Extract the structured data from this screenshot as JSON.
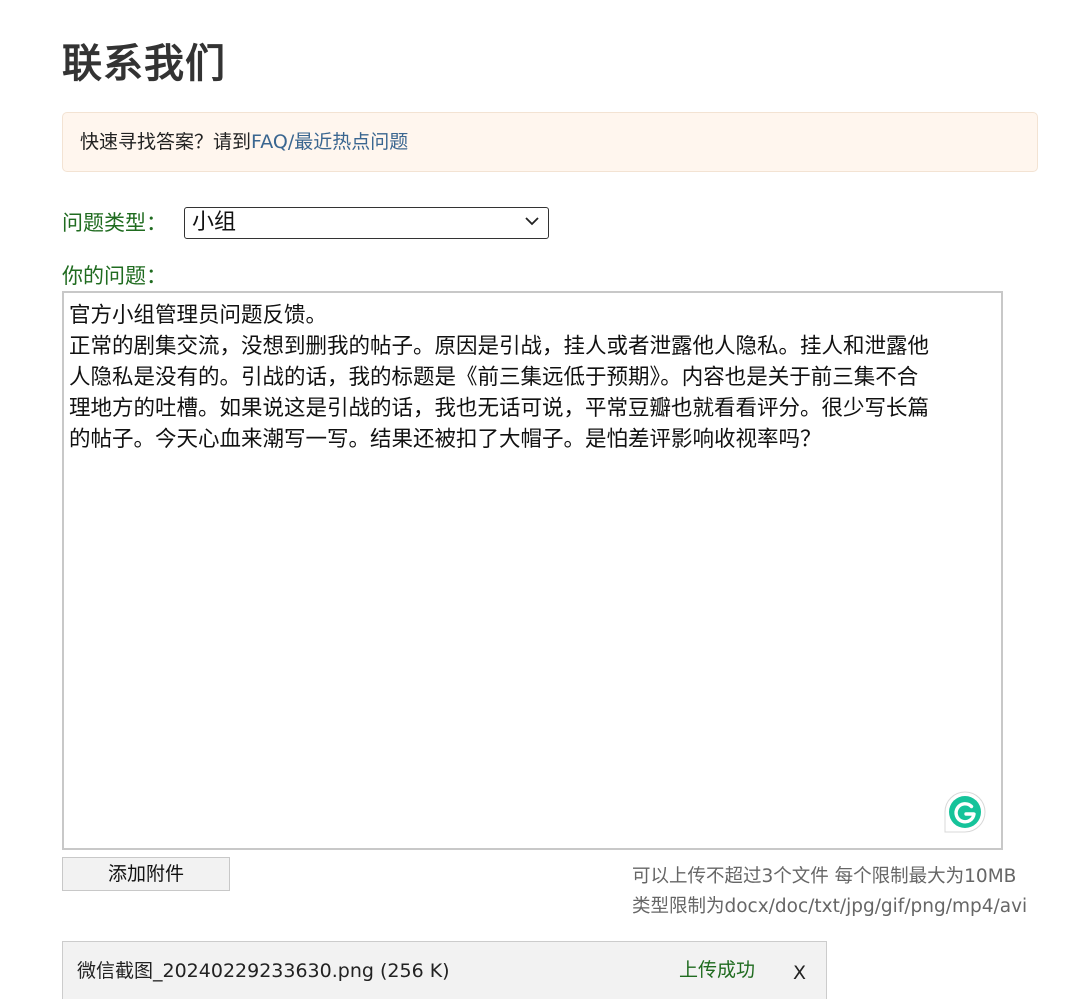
{
  "page": {
    "title": "联系我们"
  },
  "notice": {
    "prefix": "快速寻找答案？请到",
    "link_text": "FAQ/最近热点问题"
  },
  "form": {
    "type_label": "问题类型：",
    "type_selected": "小组",
    "question_label": "你的问题：",
    "question_lines": [
      "官方小组管理员问题反馈。",
      "正常的剧集交流，没想到删我的帖子。原因是引战，挂人或者泄露他人隐私。挂人和泄露他",
      "人隐私是没有的。引战的话，我的标题是《前三集远低于预期》。内容也是关于前三集不合",
      "理地方的吐槽。如果说这是引战的话，我也无话可说，平常豆瓣也就看看评分。很少写长篇",
      "的帖子。今天心血来潮写一写。结果还被扣了大帽子。是怕差评影响收视率吗？"
    ]
  },
  "attachments": {
    "button_label": "添加附件",
    "limit_text": "可以上传不超过3个文件 每个限制最大为10MB",
    "types_text": "类型限制为docx/doc/txt/jpg/gif/png/mp4/avi",
    "files": [
      {
        "name": "微信截图_20240229233630.png (256 K)",
        "status": "上传成功",
        "remove": "X"
      }
    ]
  },
  "colors": {
    "label_green": "#1f6b1f",
    "link_blue": "#3a6690",
    "notice_bg": "#fff6ee",
    "grammarly_green": "#15c39a"
  },
  "icons": {
    "select_arrow": "chevron-down-icon",
    "grammarly": "grammarly-icon"
  }
}
